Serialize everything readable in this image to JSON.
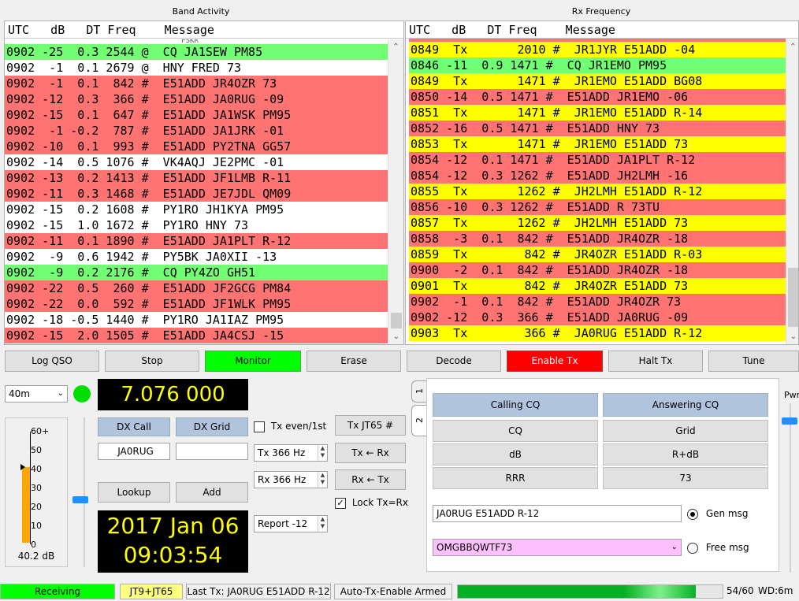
{
  "band_activity": {
    "title": "Band Activity",
    "header": "UTC   dB   DT Freq    Message",
    "partial_top": "                                         PSKR",
    "rows": [
      {
        "text": "0902 -25  0.3 2544 @  CQ JA1SEW PM85",
        "color": "green"
      },
      {
        "text": "0902  -1  0.1 2679 @  HNY FRED 73",
        "color": "white"
      },
      {
        "text": "0902  -1  0.1  842 #  E51ADD JR4OZR 73",
        "color": "red"
      },
      {
        "text": "0902 -12  0.3  366 #  E51ADD JA0RUG -09",
        "color": "red"
      },
      {
        "text": "0902 -15  0.1  647 #  E51ADD JA1WSK PM95",
        "color": "red"
      },
      {
        "text": "0902  -1 -0.2  787 #  E51ADD JA1JRK -01",
        "color": "red"
      },
      {
        "text": "0902 -10  0.1  993 #  E51ADD PY2TNA GG57",
        "color": "red"
      },
      {
        "text": "0902 -14  0.5 1076 #  VK4AQJ JE2PMC -01",
        "color": "white"
      },
      {
        "text": "0902 -13  0.2 1413 #  E51ADD JF1LMB R-11",
        "color": "red"
      },
      {
        "text": "0902 -11  0.3 1468 #  E51ADD JE7JDL QM09",
        "color": "red"
      },
      {
        "text": "0902 -15  0.2 1608 #  PY1RO JH1KYA PM95",
        "color": "white"
      },
      {
        "text": "0902 -15  1.0 1672 #  PY1RO HNY 73",
        "color": "white"
      },
      {
        "text": "0902 -11  0.1 1890 #  E51ADD JA1PLT R-12",
        "color": "red"
      },
      {
        "text": "0902  -9  0.6 1942 #  PY5BK JA0XII -13",
        "color": "white"
      },
      {
        "text": "0902  -9  0.2 2176 #  CQ PY4ZO GH51",
        "color": "green"
      },
      {
        "text": "0902 -22  0.5  260 #  E51ADD JF2GCG PM84",
        "color": "red"
      },
      {
        "text": "0902 -22  0.0  592 #  E51ADD JF1WLK PM95",
        "color": "red"
      },
      {
        "text": "0902 -18 -0.5 1440 #  PY1RO JA1IAZ PM95",
        "color": "white"
      },
      {
        "text": "0902 -15  2.0 1505 #  E51ADD JA4CSJ -15",
        "color": "red"
      }
    ]
  },
  "rx_frequency": {
    "title": "Rx Frequency",
    "header": "UTC   dB   DT Freq    Message",
    "rows": [
      {
        "text": "0849  Tx       2010 #  JR1JYR E51ADD -04",
        "color": "yellow"
      },
      {
        "text": "0846 -11  0.9 1471 #  CQ JR1EMO PM95",
        "color": "green"
      },
      {
        "text": "0849  Tx       1471 #  JR1EMO E51ADD BG08",
        "color": "yellow"
      },
      {
        "text": "0850 -14  0.5 1471 #  E51ADD JR1EMO -06",
        "color": "red"
      },
      {
        "text": "0851  Tx       1471 #  JR1EMO E51ADD R-14",
        "color": "yellow"
      },
      {
        "text": "0852 -16  0.5 1471 #  E51ADD HNY 73",
        "color": "red"
      },
      {
        "text": "0853  Tx       1471 #  JR1EMO E51ADD 73",
        "color": "yellow"
      },
      {
        "text": "0854 -12  0.1 1471 #  E51ADD JA1PLT R-12",
        "color": "red"
      },
      {
        "text": "0854 -12  0.3 1262 #  E51ADD JH2LMH -16",
        "color": "red"
      },
      {
        "text": "0855  Tx       1262 #  JH2LMH E51ADD R-12",
        "color": "yellow"
      },
      {
        "text": "0856 -10  0.3 1262 #  E51ADD R 73TU",
        "color": "red"
      },
      {
        "text": "0857  Tx       1262 #  JH2LMH E51ADD 73",
        "color": "yellow"
      },
      {
        "text": "0858  -3  0.1  842 #  E51ADD JR4OZR -18",
        "color": "red"
      },
      {
        "text": "0859  Tx        842 #  JR4OZR E51ADD R-03",
        "color": "yellow"
      },
      {
        "text": "0900  -2  0.1  842 #  E51ADD JR4OZR -18",
        "color": "red"
      },
      {
        "text": "0901  Tx        842 #  JR4OZR E51ADD 73",
        "color": "yellow"
      },
      {
        "text": "0902  -1  0.1  842 #  E51ADD JR4OZR 73",
        "color": "red"
      },
      {
        "text": "0902 -12  0.3  366 #  E51ADD JA0RUG -09",
        "color": "red"
      },
      {
        "text": "0903  Tx        366 #  JA0RUG E51ADD R-12",
        "color": "yellow"
      }
    ]
  },
  "buttons": {
    "log_qso": "Log QSO",
    "stop": "Stop",
    "monitor": "Monitor",
    "erase": "Erase",
    "decode": "Decode",
    "enable_tx": "Enable Tx",
    "halt_tx": "Halt Tx",
    "tune": "Tune"
  },
  "left": {
    "band": "40m",
    "frequency": "7.076 000",
    "dx_call_label": "DX Call",
    "dx_grid_label": "DX Grid",
    "dx_call_value": "JA0RUG",
    "dx_grid_value": "",
    "lookup": "Lookup",
    "add": "Add",
    "date": "2017 Jan 06",
    "time": "09:03:54",
    "meter_ticks": [
      "60+",
      "50",
      "40",
      "30",
      "20",
      "10",
      "0"
    ],
    "meter_reading": "40.2 dB",
    "meter_level_db": 40.2,
    "tx_even_label": "Tx even/1st",
    "tx_mode_btn": "Tx JT65  #",
    "tx_freq": "Tx  366  Hz",
    "rx_freq": "Rx  366  Hz",
    "tx_from_rx": "Tx ← Rx",
    "rx_from_tx": "Rx ← Tx",
    "lock_label": "Lock Tx=Rx",
    "report": "Report -12"
  },
  "messages": {
    "tab1": "1",
    "tab2": "2",
    "calling_cq": "Calling CQ",
    "answering_cq": "Answering CQ",
    "cq": "CQ",
    "grid": "Grid",
    "db": "dB",
    "r_db": "R+dB",
    "rrr": "RRR",
    "seventy_three": "73",
    "gen_msg_value": "JA0RUG E51ADD R-12",
    "gen_msg_label": "Gen msg",
    "free_msg_value": "OMGBBQWTF73",
    "free_msg_label": "Free msg",
    "pwr_label": "Pwr"
  },
  "status": {
    "receiving": "Receiving",
    "mode": "JT9+JT65",
    "last_tx": "Last Tx:  JA0RUG E51ADD R-12",
    "auto_tx": "Auto-Tx-Enable Armed",
    "progress": "54/60",
    "progress_fraction": 0.9,
    "wd": "WD:6m"
  },
  "colors": {
    "red": "#ff7373",
    "green": "#73ff73",
    "yellow": "#ffff00",
    "white": "#ffffff",
    "lcd_text": "#ffff00"
  }
}
